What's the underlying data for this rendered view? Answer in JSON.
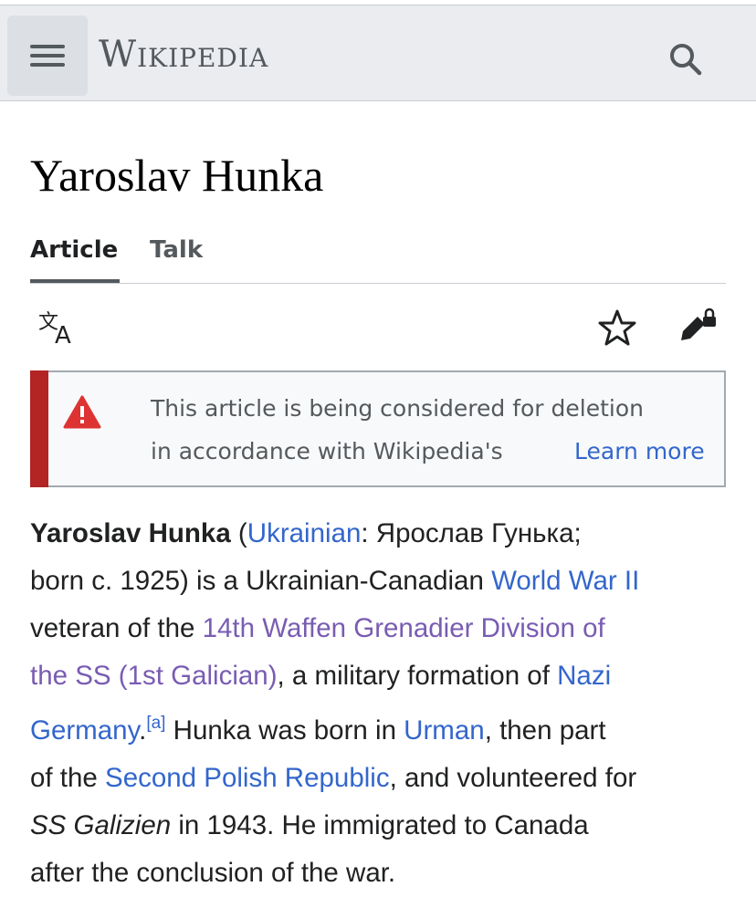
{
  "header": {
    "logo": "Wikipedia",
    "menu_icon": "hamburger-menu-icon",
    "search_icon": "search-icon"
  },
  "page": {
    "title": "Yaroslav Hunka",
    "tabs": [
      {
        "label": "Article",
        "selected": true
      },
      {
        "label": "Talk",
        "selected": false
      }
    ],
    "toolbar": {
      "language_icon": "translate-icon",
      "watch_icon": "star-icon",
      "edit_icon": "edit-locked-icon"
    }
  },
  "notice": {
    "icon": "warning-icon",
    "line1": "This article is being considered for deletion",
    "line2": "in accordance with Wikipedia's",
    "learn_more": "Learn more",
    "stripe_color": "#b32424"
  },
  "article": {
    "l1": {
      "bold": "Yaroslav Hunka",
      "t1": " (",
      "link1": "Ukrainian",
      "t2": ": Ярослав Гунька;"
    },
    "l2": {
      "t1": "born c. 1925) is a Ukrainian-Canadian ",
      "link1": "World War II"
    },
    "l3": {
      "t1": "veteran of the ",
      "link1": "14th Waffen Grenadier Division of"
    },
    "l4": {
      "link1": "the SS (1st Galician)",
      "t1": ", a military formation of ",
      "link2": "Nazi"
    },
    "l5": {
      "link1": "Germany",
      "t1": ".",
      "sup": "[a]",
      "t2": " Hunka was born in ",
      "link2": "Urman",
      "t3": ", then part"
    },
    "l6": {
      "t1": "of the ",
      "link1": "Second Polish Republic",
      "t2": ", and volunteered for"
    },
    "l7": {
      "italic": "SS Galizien",
      "t1": " in 1943. He immigrated to Canada"
    },
    "l8": {
      "t1": "after the conclusion of the war."
    }
  },
  "colors": {
    "link": "#3366cc",
    "visited_link": "#795cb2",
    "header_bg": "#eaecf0"
  }
}
